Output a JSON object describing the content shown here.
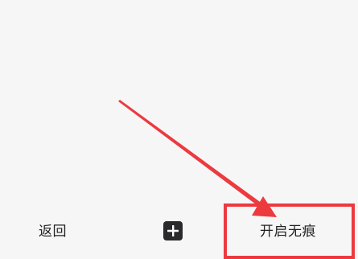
{
  "toolbar": {
    "back_label": "返回",
    "add_icon": "plus-icon",
    "incognito_label": "开启无痕"
  },
  "annotation": {
    "color": "#ec3a3f"
  },
  "colors": {
    "background": "#f6f6f7",
    "text": "#222222",
    "add_button_bg": "#2a2a2c"
  }
}
